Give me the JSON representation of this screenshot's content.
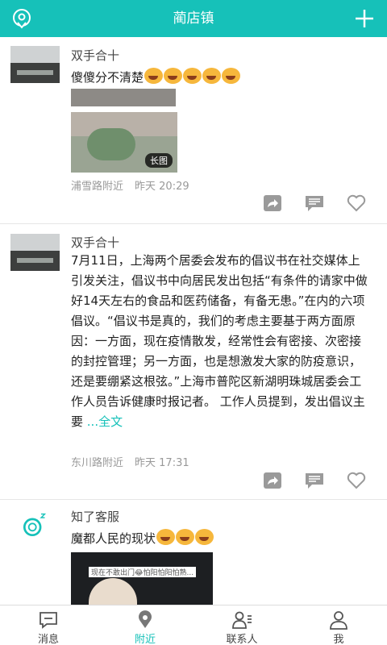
{
  "header": {
    "title": "蔺店镇"
  },
  "posts": [
    {
      "name": "双手合十",
      "text": "傻傻分不清楚",
      "image_badge": "长图",
      "location": "浦雪路附近",
      "time": "昨天 20:29"
    },
    {
      "name": "双手合十",
      "text": "7月11日，上海两个居委会发布的倡议书在社交媒体上引发关注，倡议书中向居民发出包括“有条件的请家中做好14天左右的食品和医药储备，有备无患。”在内的六项倡议。“倡议书是真的，我们的考虑主要基于两方面原因：一方面，现在疫情散发，经常性会有密接、次密接的封控管理；另一方面，也是想激发大家的防疫意识，还是要绷紧这根弦。”上海市普陀区新湖明珠城居委会工作人员告诉健康时报记者。 工作人员提到，发出倡议主要",
      "more": " ...全文",
      "location": "东川路附近",
      "time": "昨天 17:31"
    },
    {
      "name": "知了客服",
      "text": "魔都人民的现状",
      "image_text": "现在不敢出门😂怕阳怕阳怕熟..."
    }
  ],
  "tabs": [
    {
      "label": "消息",
      "icon": "message-icon"
    },
    {
      "label": "附近",
      "icon": "location-icon"
    },
    {
      "label": "联系人",
      "icon": "contacts-icon"
    },
    {
      "label": "我",
      "icon": "profile-icon"
    }
  ],
  "colors": {
    "accent": "#16c1b9"
  }
}
